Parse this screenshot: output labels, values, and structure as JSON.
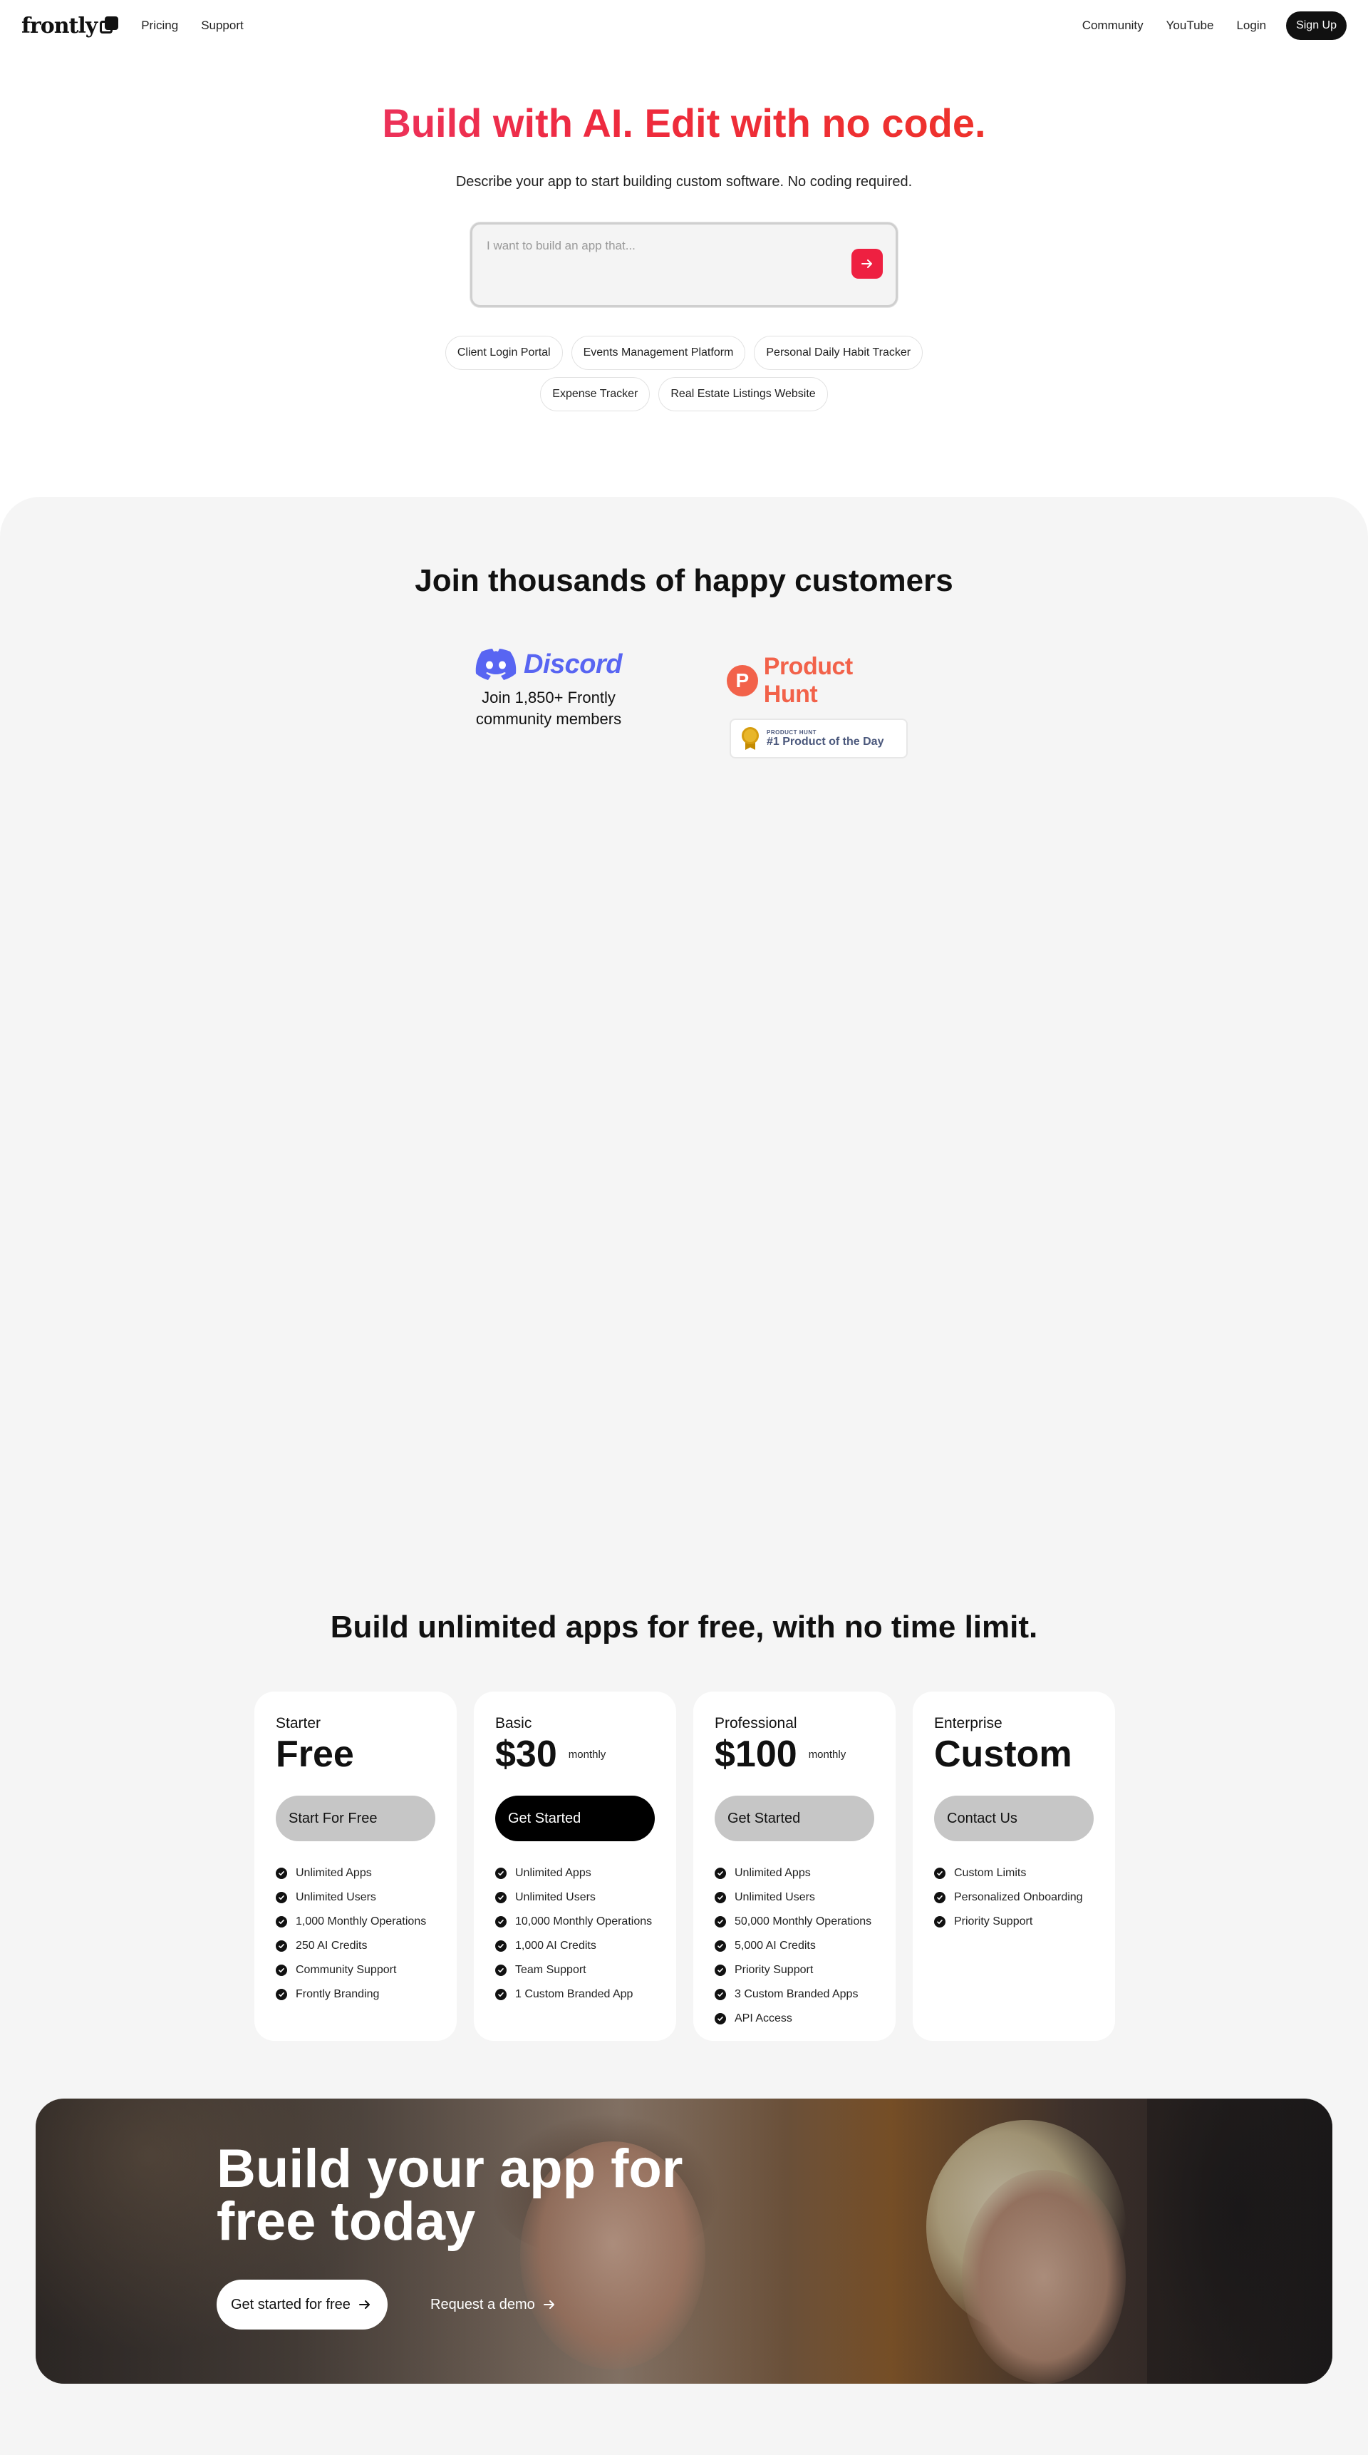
{
  "nav": {
    "logo": "frontly",
    "left_links": [
      "Pricing",
      "Support"
    ],
    "right_links": [
      "Community",
      "YouTube",
      "Login"
    ],
    "signup": "Sign Up"
  },
  "hero": {
    "title": "Build with AI. Edit with no code.",
    "subtitle": "Describe your app to start building custom software. No coding required.",
    "prompt_placeholder": "I want to build an app that...",
    "chips_row1": [
      "Client Login Portal",
      "Events Management Platform",
      "Personal Daily Habit Tracker"
    ],
    "chips_row2": [
      "Expense Tracker",
      "Real Estate Listings Website"
    ]
  },
  "social": {
    "title": "Join thousands of happy customers",
    "discord_name": "Discord",
    "discord_text": "Join 1,850+ Frontly community members",
    "producthunt_name": "Product Hunt",
    "ph_badge_small": "PRODUCT HUNT",
    "ph_badge_big": "#1 Product of the Day",
    "colors": {
      "discord": "#5865f2",
      "producthunt": "#f2624a"
    }
  },
  "pricing": {
    "title": "Build unlimited apps for free, with no time limit.",
    "plans": [
      {
        "name": "Starter",
        "price": "Free",
        "period": "",
        "button": "Start For Free",
        "features": [
          "Unlimited Apps",
          "Unlimited Users",
          "1,000 Monthly Operations",
          "250 AI Credits",
          "Community Support",
          "Frontly Branding"
        ]
      },
      {
        "name": "Basic",
        "price": "$30",
        "period": "monthly",
        "button": "Get Started",
        "features": [
          "Unlimited Apps",
          "Unlimited Users",
          "10,000 Monthly Operations",
          "1,000 AI Credits",
          "Team Support",
          "1 Custom Branded App"
        ]
      },
      {
        "name": "Professional",
        "price": "$100",
        "period": "monthly",
        "button": "Get Started",
        "features": [
          "Unlimited Apps",
          "Unlimited Users",
          "50,000 Monthly Operations",
          "5,000 AI Credits",
          "Priority Support",
          "3 Custom Branded Apps",
          "API Access"
        ]
      },
      {
        "name": "Enterprise",
        "price": "Custom",
        "period": "",
        "button": "Contact Us",
        "features": [
          "Custom Limits",
          "Personalized Onboarding",
          "Priority Support"
        ]
      }
    ]
  },
  "cta": {
    "title_line1": "Build your app for",
    "title_line2": "free today",
    "primary": "Get started for free",
    "secondary": "Request a demo"
  },
  "colors": {
    "accent": "#ee2041",
    "text": "#111111",
    "section_bg": "#f5f5f5"
  }
}
